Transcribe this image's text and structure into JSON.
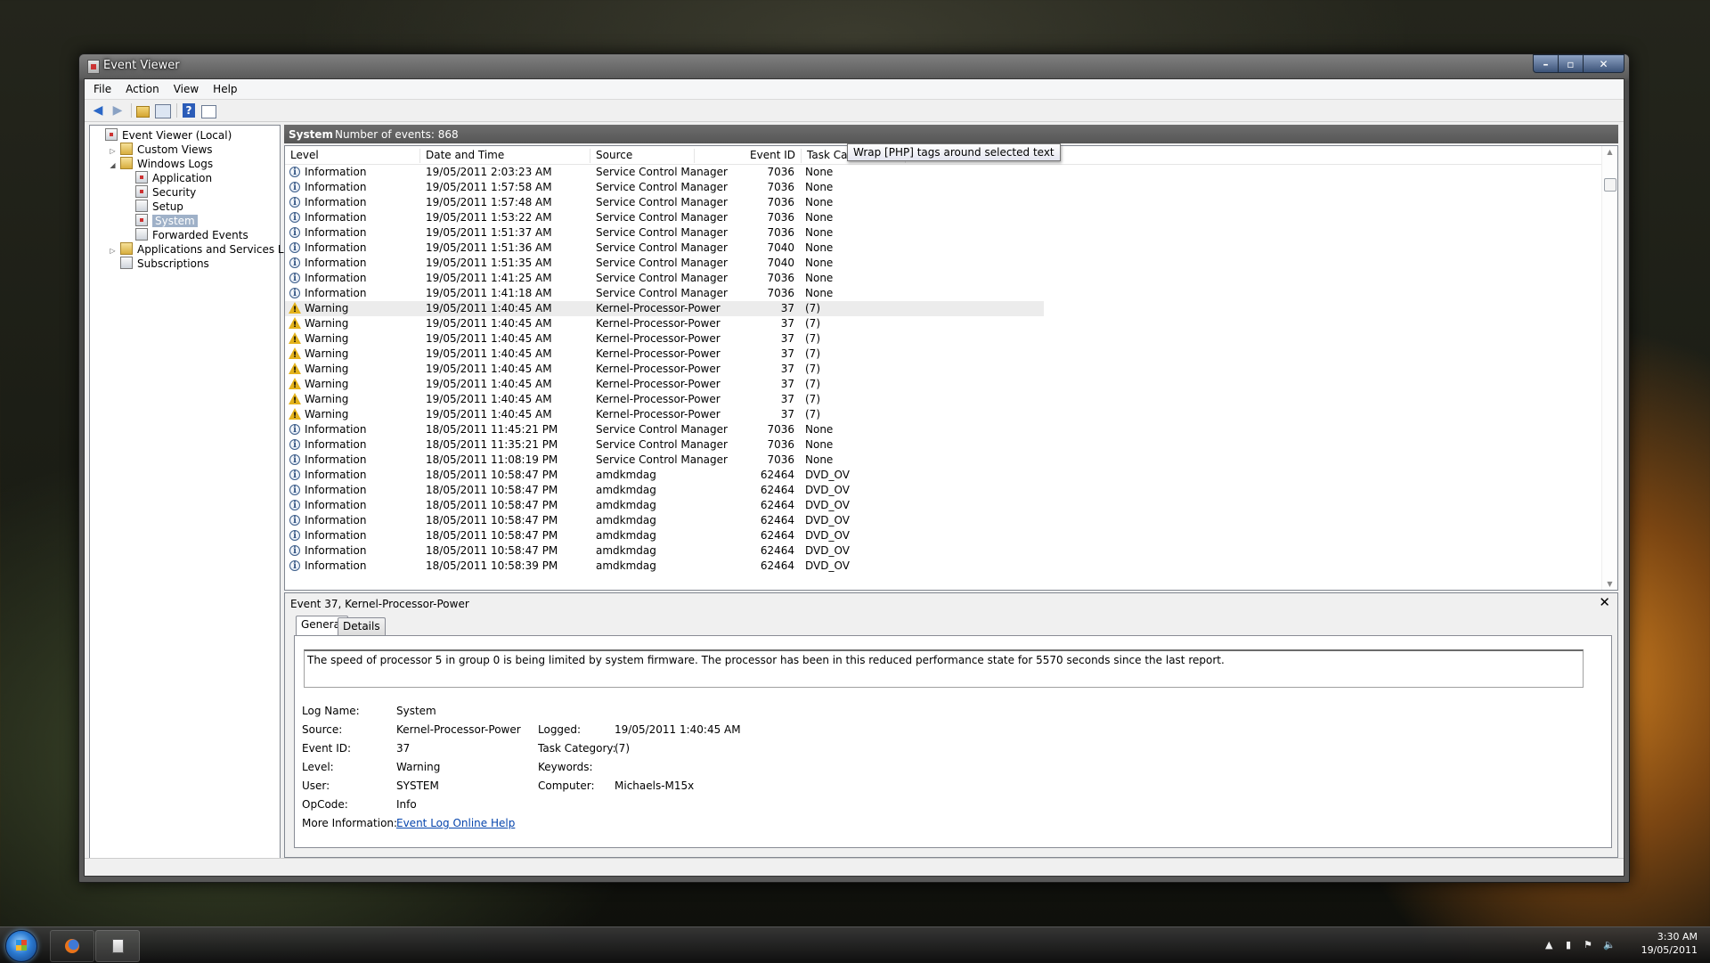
{
  "window": {
    "title": "Event Viewer"
  },
  "menu": [
    "File",
    "Action",
    "View",
    "Help"
  ],
  "tree": {
    "items": [
      {
        "label": "Event Viewer (Local)",
        "indent": 0,
        "expander": "",
        "icon": "log",
        "selected": false
      },
      {
        "label": "Custom Views",
        "indent": 1,
        "expander": "▷",
        "icon": "folder",
        "selected": false
      },
      {
        "label": "Windows Logs",
        "indent": 1,
        "expander": "◢",
        "icon": "folder",
        "selected": false
      },
      {
        "label": "Application",
        "indent": 2,
        "expander": "",
        "icon": "log",
        "selected": false
      },
      {
        "label": "Security",
        "indent": 2,
        "expander": "",
        "icon": "log",
        "selected": false
      },
      {
        "label": "Setup",
        "indent": 2,
        "expander": "",
        "icon": "page",
        "selected": false
      },
      {
        "label": "System",
        "indent": 2,
        "expander": "",
        "icon": "log",
        "selected": true
      },
      {
        "label": "Forwarded Events",
        "indent": 2,
        "expander": "",
        "icon": "page",
        "selected": false
      },
      {
        "label": "Applications and Services Logs",
        "indent": 1,
        "expander": "▷",
        "icon": "folder",
        "selected": false
      },
      {
        "label": "Subscriptions",
        "indent": 1,
        "expander": "",
        "icon": "page",
        "selected": false
      }
    ]
  },
  "list_header": {
    "log_name": "System",
    "count_text": "Number of events: 868"
  },
  "columns": [
    "Level",
    "Date and Time",
    "Source",
    "Event ID",
    "Task Category"
  ],
  "events": [
    {
      "level": "Information",
      "icon": "info",
      "datetime": "19/05/2011 2:03:23 AM",
      "source": "Service Control Manager",
      "event_id": "7036",
      "task": "None"
    },
    {
      "level": "Information",
      "icon": "info",
      "datetime": "19/05/2011 1:57:58 AM",
      "source": "Service Control Manager",
      "event_id": "7036",
      "task": "None"
    },
    {
      "level": "Information",
      "icon": "info",
      "datetime": "19/05/2011 1:57:48 AM",
      "source": "Service Control Manager",
      "event_id": "7036",
      "task": "None"
    },
    {
      "level": "Information",
      "icon": "info",
      "datetime": "19/05/2011 1:53:22 AM",
      "source": "Service Control Manager",
      "event_id": "7036",
      "task": "None"
    },
    {
      "level": "Information",
      "icon": "info",
      "datetime": "19/05/2011 1:51:37 AM",
      "source": "Service Control Manager",
      "event_id": "7036",
      "task": "None"
    },
    {
      "level": "Information",
      "icon": "info",
      "datetime": "19/05/2011 1:51:36 AM",
      "source": "Service Control Manager",
      "event_id": "7040",
      "task": "None"
    },
    {
      "level": "Information",
      "icon": "info",
      "datetime": "19/05/2011 1:51:35 AM",
      "source": "Service Control Manager",
      "event_id": "7040",
      "task": "None"
    },
    {
      "level": "Information",
      "icon": "info",
      "datetime": "19/05/2011 1:41:25 AM",
      "source": "Service Control Manager",
      "event_id": "7036",
      "task": "None"
    },
    {
      "level": "Information",
      "icon": "info",
      "datetime": "19/05/2011 1:41:18 AM",
      "source": "Service Control Manager",
      "event_id": "7036",
      "task": "None"
    },
    {
      "level": "Warning",
      "icon": "warn",
      "datetime": "19/05/2011 1:40:45 AM",
      "source": "Kernel-Processor-Power",
      "event_id": "37",
      "task": "(7)",
      "highlight": true
    },
    {
      "level": "Warning",
      "icon": "warn",
      "datetime": "19/05/2011 1:40:45 AM",
      "source": "Kernel-Processor-Power",
      "event_id": "37",
      "task": "(7)"
    },
    {
      "level": "Warning",
      "icon": "warn",
      "datetime": "19/05/2011 1:40:45 AM",
      "source": "Kernel-Processor-Power",
      "event_id": "37",
      "task": "(7)"
    },
    {
      "level": "Warning",
      "icon": "warn",
      "datetime": "19/05/2011 1:40:45 AM",
      "source": "Kernel-Processor-Power",
      "event_id": "37",
      "task": "(7)"
    },
    {
      "level": "Warning",
      "icon": "warn",
      "datetime": "19/05/2011 1:40:45 AM",
      "source": "Kernel-Processor-Power",
      "event_id": "37",
      "task": "(7)"
    },
    {
      "level": "Warning",
      "icon": "warn",
      "datetime": "19/05/2011 1:40:45 AM",
      "source": "Kernel-Processor-Power",
      "event_id": "37",
      "task": "(7)"
    },
    {
      "level": "Warning",
      "icon": "warn",
      "datetime": "19/05/2011 1:40:45 AM",
      "source": "Kernel-Processor-Power",
      "event_id": "37",
      "task": "(7)"
    },
    {
      "level": "Warning",
      "icon": "warn",
      "datetime": "19/05/2011 1:40:45 AM",
      "source": "Kernel-Processor-Power",
      "event_id": "37",
      "task": "(7)"
    },
    {
      "level": "Information",
      "icon": "info",
      "datetime": "18/05/2011 11:45:21 PM",
      "source": "Service Control Manager",
      "event_id": "7036",
      "task": "None"
    },
    {
      "level": "Information",
      "icon": "info",
      "datetime": "18/05/2011 11:35:21 PM",
      "source": "Service Control Manager",
      "event_id": "7036",
      "task": "None"
    },
    {
      "level": "Information",
      "icon": "info",
      "datetime": "18/05/2011 11:08:19 PM",
      "source": "Service Control Manager",
      "event_id": "7036",
      "task": "None"
    },
    {
      "level": "Information",
      "icon": "info",
      "datetime": "18/05/2011 10:58:47 PM",
      "source": "amdkmdag",
      "event_id": "62464",
      "task": "DVD_OV"
    },
    {
      "level": "Information",
      "icon": "info",
      "datetime": "18/05/2011 10:58:47 PM",
      "source": "amdkmdag",
      "event_id": "62464",
      "task": "DVD_OV"
    },
    {
      "level": "Information",
      "icon": "info",
      "datetime": "18/05/2011 10:58:47 PM",
      "source": "amdkmdag",
      "event_id": "62464",
      "task": "DVD_OV"
    },
    {
      "level": "Information",
      "icon": "info",
      "datetime": "18/05/2011 10:58:47 PM",
      "source": "amdkmdag",
      "event_id": "62464",
      "task": "DVD_OV"
    },
    {
      "level": "Information",
      "icon": "info",
      "datetime": "18/05/2011 10:58:47 PM",
      "source": "amdkmdag",
      "event_id": "62464",
      "task": "DVD_OV"
    },
    {
      "level": "Information",
      "icon": "info",
      "datetime": "18/05/2011 10:58:47 PM",
      "source": "amdkmdag",
      "event_id": "62464",
      "task": "DVD_OV"
    },
    {
      "level": "Information",
      "icon": "info",
      "datetime": "18/05/2011 10:58:39 PM",
      "source": "amdkmdag",
      "event_id": "62464",
      "task": "DVD_OV"
    }
  ],
  "tooltip": "Wrap [PHP] tags around selected text",
  "detail": {
    "title": "Event 37, Kernel-Processor-Power",
    "tabs": [
      "General",
      "Details"
    ],
    "message": "The speed of processor 5 in group 0 is being limited by system firmware. The processor has been in this reduced performance state for 5570 seconds since the last report.",
    "labels": {
      "log_name": "Log Name:",
      "source": "Source:",
      "event_id": "Event ID:",
      "level": "Level:",
      "user": "User:",
      "opcode": "OpCode:",
      "more_info": "More Information:",
      "logged": "Logged:",
      "task_category": "Task Category:",
      "keywords": "Keywords:",
      "computer": "Computer:"
    },
    "values": {
      "log_name": "System",
      "source": "Kernel-Processor-Power",
      "event_id": "37",
      "level": "Warning",
      "user": "SYSTEM",
      "opcode": "Info",
      "more_info_link": "Event Log Online Help",
      "logged": "19/05/2011 1:40:45 AM",
      "task_category": "(7)",
      "keywords": "",
      "computer": "Michaels-M15x"
    }
  },
  "taskbar": {
    "time": "3:30 AM",
    "date": "19/05/2011"
  },
  "icons": {
    "back": "arrow-left",
    "forward": "arrow-right",
    "up": "folder-up",
    "tree": "show-hide-tree",
    "help": "help",
    "properties": "properties",
    "info": "information",
    "warning": "warning"
  }
}
